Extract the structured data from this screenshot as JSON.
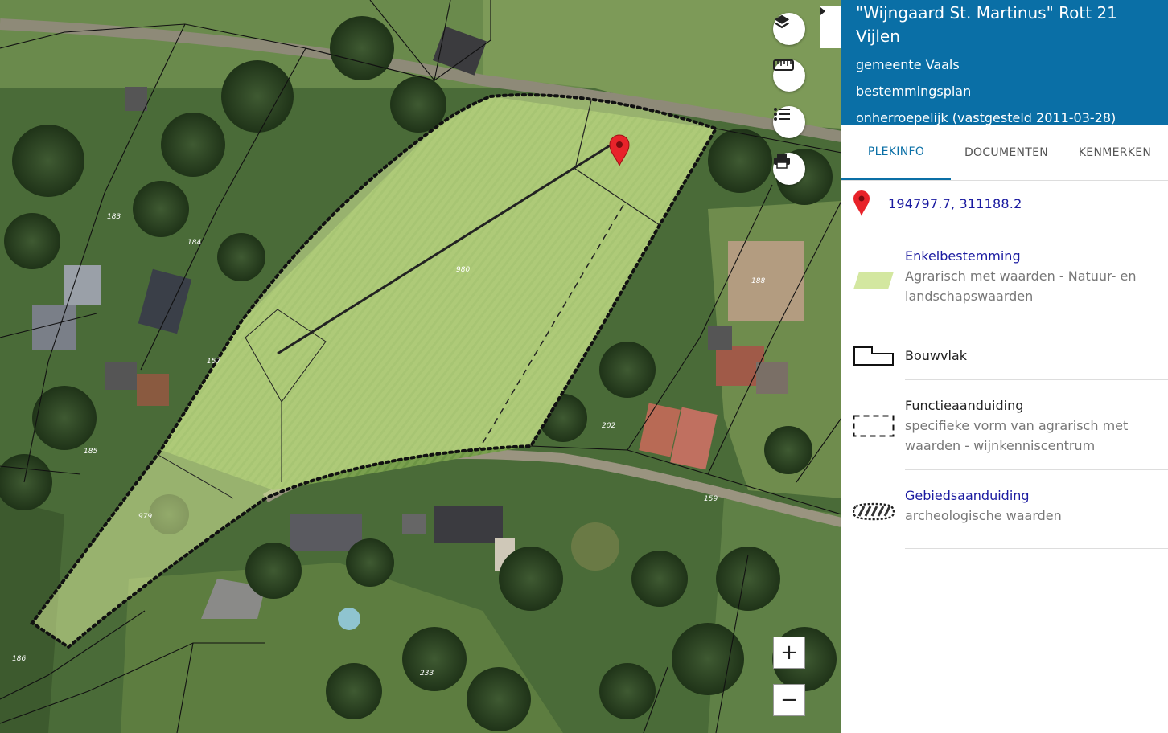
{
  "map": {
    "parcel_numbers": [
      "183",
      "184",
      "157",
      "185",
      "980",
      "979",
      "188",
      "202",
      "159",
      "186",
      "233"
    ],
    "controls": {
      "layers_icon": "layers-icon",
      "measure_icon": "ruler-icon",
      "legend_icon": "list-icon",
      "print_icon": "printer-icon",
      "zoom_in_label": "+",
      "zoom_out_label": "−",
      "collapse_icon": "caret-right-icon"
    },
    "colors": {
      "parcel_fill": "#d9ec9a",
      "parcel_line": "#1a1a1a",
      "marker": "#e8232a",
      "parcel_label": "#ffffff"
    }
  },
  "panel": {
    "title": "\"Wijngaard St. Martinus\" Rott 21 Vijlen",
    "municipality": "gemeente Vaals",
    "plan_type": "bestemmingsplan",
    "status": "onherroepelijk (vastgesteld 2011-03-28)",
    "header_color": "#0a6fa6",
    "tabs": [
      {
        "label": "PLEKINFO",
        "active": true
      },
      {
        "label": "DOCUMENTEN",
        "active": false
      },
      {
        "label": "KENMERKEN",
        "active": false
      }
    ],
    "coordinates": "194797.7, 311188.2",
    "legend": [
      {
        "title": "Enkelbestemming",
        "description": "Agrarisch met waarden - Natuur- en landschapswaarden",
        "icon": "green-parallelogram-icon",
        "link": true
      },
      {
        "title": "Bouwvlak",
        "description": "",
        "icon": "bouwvlak-outline-icon",
        "link": false
      },
      {
        "title": "Functieaanduiding",
        "description": "specifieke vorm van agrarisch met waarden - wijnkenniscentrum",
        "icon": "dashed-rectangle-icon",
        "link": false
      },
      {
        "title": "Gebiedsaanduiding",
        "description": "archeologische waarden",
        "icon": "hatched-area-icon",
        "link": true
      }
    ]
  }
}
